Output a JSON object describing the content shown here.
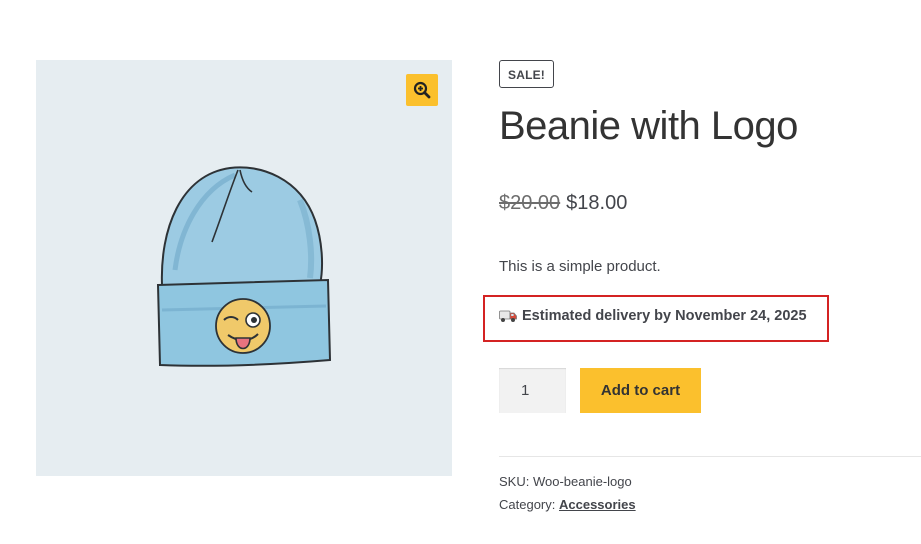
{
  "product": {
    "sale_badge": "SALE!",
    "title": "Beanie with Logo",
    "regular_price": "$20.00",
    "sale_price": "$18.00",
    "short_description": "This is a simple product.",
    "delivery_text": "Estimated delivery by November 24, 2025",
    "quantity": "1",
    "add_to_cart_label": "Add to cart",
    "sku_label": "SKU:",
    "sku_value": "Woo-beanie-logo",
    "category_label": "Category:",
    "category_value": "Accessories"
  },
  "gallery": {
    "zoom_icon": "magnify-plus-icon",
    "image": "beanie-hat-with-winking-emoji"
  },
  "colors": {
    "accent_yellow": "#fbc02d",
    "highlight_red": "#d42323",
    "gallery_bg": "#e6edf1",
    "hat_blue": "#8fc6e0"
  }
}
